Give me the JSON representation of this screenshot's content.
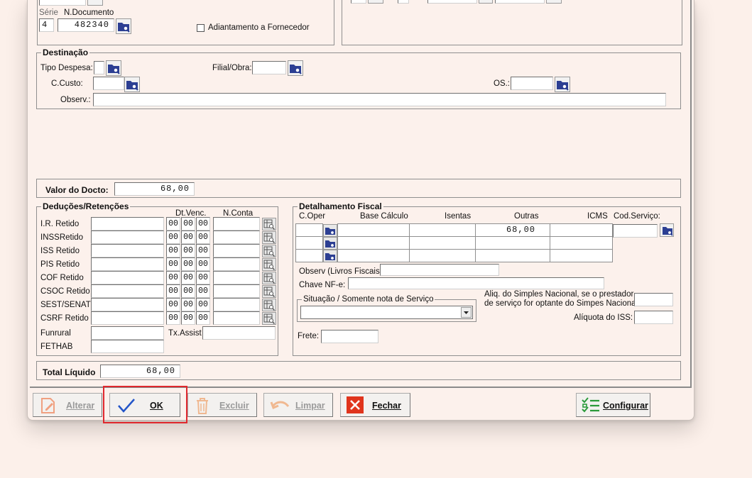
{
  "top_left": {
    "serie_label": "Série",
    "doc_label": "N.Documento",
    "serie_value": "4",
    "doc_value": "482340",
    "adiantamento_label": "Adiantamento a Fornecedor"
  },
  "destinacao": {
    "title": "Destinação",
    "tipo_despesa_label": "Tipo Despesa:",
    "filial_obra_label": "Filial/Obra:",
    "ccusto_label": "C.Custo:",
    "os_label": "OS.:",
    "observ_label": "Observ.:"
  },
  "valor_docto": {
    "label": "Valor do Docto:",
    "value": "68,00"
  },
  "deducoes": {
    "title": "Deduções/Retenções",
    "col_dtvenc": "Dt.Venc.",
    "col_nconta": "N.Conta",
    "date_part": "00",
    "rows": [
      {
        "label": "I.R. Retido"
      },
      {
        "label": "INSSRetido"
      },
      {
        "label": "ISS Retido"
      },
      {
        "label": "PIS Retido"
      },
      {
        "label": "COF Retido"
      },
      {
        "label": "CSOC Retido"
      },
      {
        "label": "SEST/SENAT"
      },
      {
        "label": "CSRF Retido"
      }
    ],
    "funrural_label": "Funrural",
    "fethab_label": "FETHAB",
    "txassist_label": "Tx.Assist"
  },
  "fiscal": {
    "title": "Detalhamento Fiscal",
    "col_coper": "C.Oper",
    "col_base": "Base Cálculo",
    "col_isentas": "Isentas",
    "col_outras": "Outras",
    "col_icms": "ICMS",
    "col_codserv": "Cod.Serviço:",
    "row1_outras": "68,00",
    "observ_label": "Observ (Livros Fiscais):",
    "chave_label": "Chave NF-e:",
    "situacao_label": "Situação / Somente nota de Serviço",
    "aliq_simples_line1": "Aliq. do Simples Nacional, se o prestador",
    "aliq_simples_line2": "de serviço for optante do Simpes Nacional.",
    "aliq_iss_label": "Alíquota do ISS:",
    "frete_label": "Frete:"
  },
  "total_liquido": {
    "label": "Total Líquido",
    "value": "68,00"
  },
  "buttons": {
    "alterar": "Alterar",
    "ok": "OK",
    "excluir": "Excluir",
    "limpar": "Limpar",
    "fechar": "Fechar",
    "configurar": "Configurar"
  },
  "colors": {
    "background": "#fcf0ea",
    "highlight": "#e0282e",
    "icon_blue": "#2c3f93",
    "ok_blue": "#2355c8",
    "fechar_red": "#e0341c",
    "config_green": "#2a9a3a"
  }
}
